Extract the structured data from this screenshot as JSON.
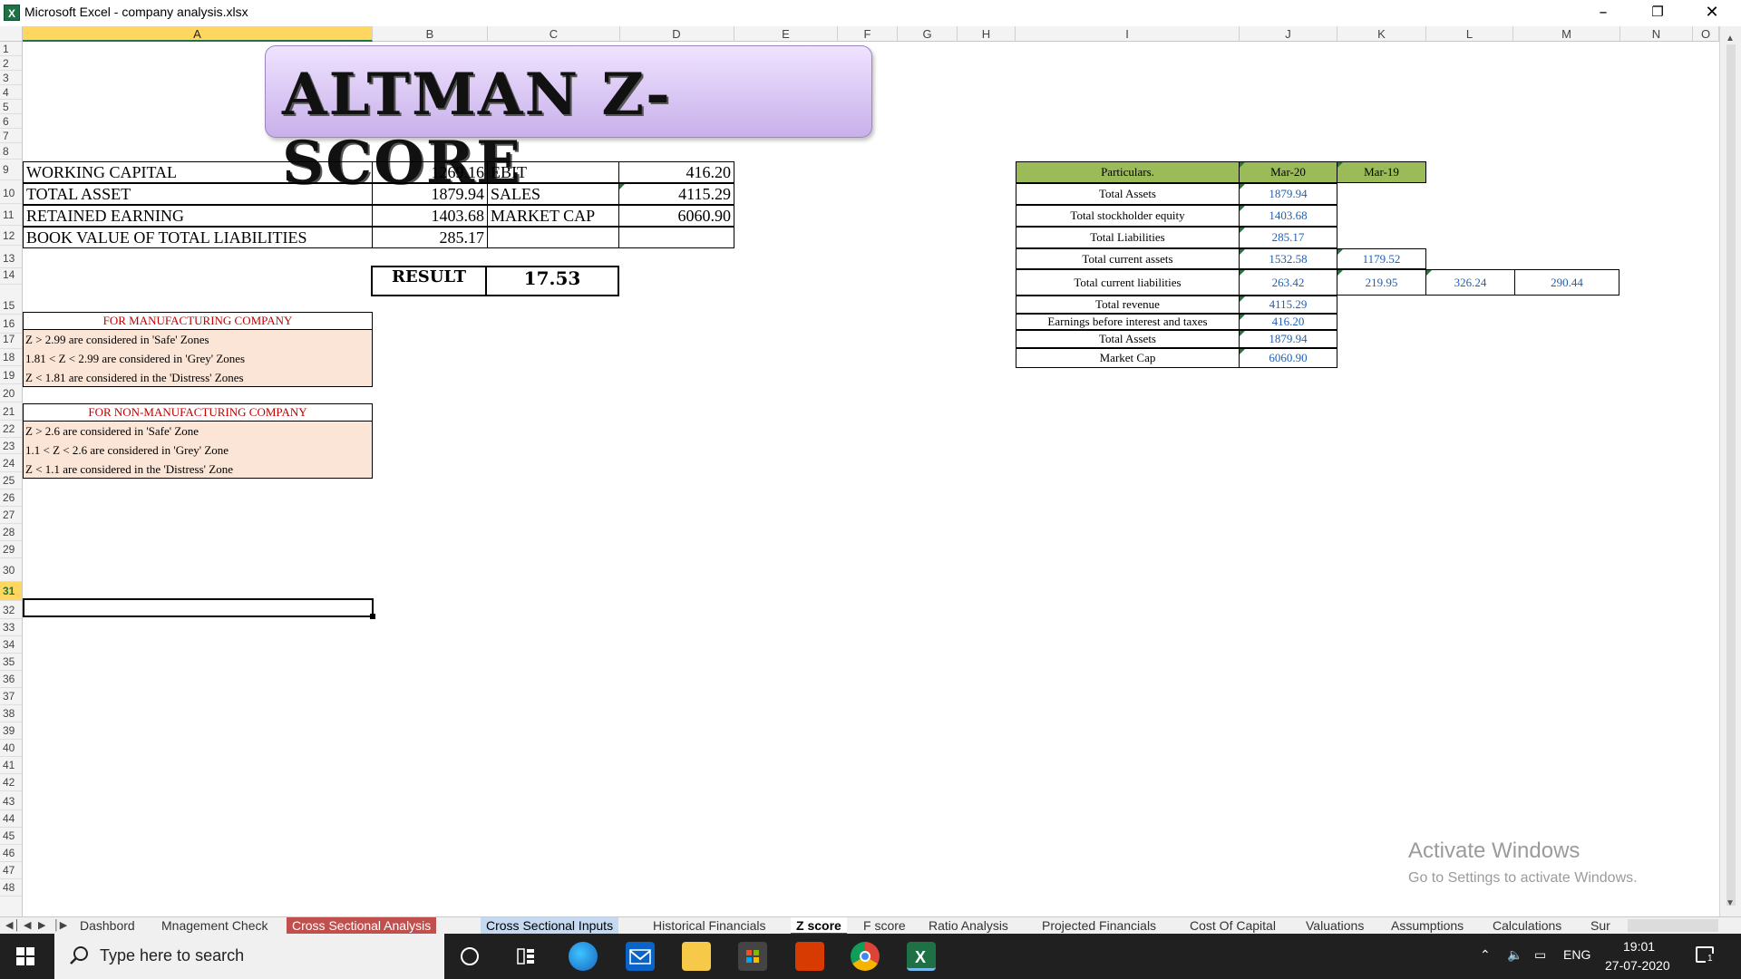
{
  "window": {
    "title": "Microsoft Excel - company analysis.xlsx",
    "app_icon": "X"
  },
  "columns": [
    "A",
    "B",
    "C",
    "D",
    "E",
    "F",
    "G",
    "H",
    "I",
    "J",
    "K",
    "L",
    "M",
    "N",
    "O"
  ],
  "rows": [
    "1",
    "2",
    "3",
    "4",
    "5",
    "6",
    "7",
    "8",
    "9",
    "10",
    "11",
    "12",
    "13",
    "14",
    "15",
    "16",
    "17",
    "18",
    "19",
    "20",
    "21",
    "22",
    "23",
    "24",
    "25",
    "26",
    "27",
    "28",
    "29",
    "30",
    "31",
    "32",
    "33",
    "34",
    "35",
    "36",
    "37",
    "38",
    "39",
    "40",
    "41",
    "42",
    "43",
    "44",
    "45",
    "46",
    "47",
    "48"
  ],
  "banner": {
    "text": "ALTMAN Z-SCORE"
  },
  "inputs": {
    "working_capital_label": "WORKING CAPITAL",
    "working_capital": "1269.16",
    "total_asset_label": "TOTAL ASSET",
    "total_asset": "1879.94",
    "retained_earning_label": "RETAINED EARNING",
    "retained_earning": "1403.68",
    "book_value_label": "BOOK VALUE OF TOTAL LIABILITIES",
    "book_value": "285.17",
    "ebit_label": "EBIT",
    "ebit": "416.20",
    "sales_label": "SALES",
    "sales": "4115.29",
    "market_cap_label": "MARKET CAP",
    "market_cap": "6060.90"
  },
  "result": {
    "label": "RESULT",
    "value": "17.53"
  },
  "manufacturing": {
    "heading": "FOR MANUFACTURING COMPANY",
    "lines": [
      "Z > 2.99 are considered in 'Safe' Zones",
      "1.81 < Z < 2.99 are considered in 'Grey' Zones",
      "Z < 1.81 are considered in the 'Distress' Zones"
    ]
  },
  "non_manufacturing": {
    "heading": "FOR NON-MANUFACTURING COMPANY",
    "lines": [
      "Z > 2.6 are considered in 'Safe' Zone",
      "1.1 < Z < 2.6 are considered in 'Grey' Zone",
      "Z < 1.1 are considered in the 'Distress' Zone"
    ]
  },
  "particulars": {
    "header": [
      "Particulars.",
      "Mar-20",
      "Mar-19"
    ],
    "rows": [
      {
        "label": "Total Assets",
        "mar20": "1879.94",
        "mar19": "",
        "l": "",
        "m": ""
      },
      {
        "label": "Total stockholder equity",
        "mar20": "1403.68",
        "mar19": "",
        "l": "",
        "m": ""
      },
      {
        "label": "Total Liabilities",
        "mar20": "285.17",
        "mar19": "",
        "l": "",
        "m": ""
      },
      {
        "label": "Total current assets",
        "mar20": "1532.58",
        "mar19": "1179.52",
        "l": "",
        "m": ""
      },
      {
        "label": "Total current liabilities",
        "mar20": "263.42",
        "mar19": "219.95",
        "l": "326.24",
        "m": "290.44"
      },
      {
        "label": "Total revenue",
        "mar20": "4115.29",
        "mar19": "",
        "l": "",
        "m": ""
      },
      {
        "label": "Earnings before interest and taxes",
        "mar20": "416.20",
        "mar19": "",
        "l": "",
        "m": ""
      },
      {
        "label": "Total Assets",
        "mar20": "1879.94",
        "mar19": "",
        "l": "",
        "m": ""
      },
      {
        "label": "Market Cap",
        "mar20": "6060.90",
        "mar19": "",
        "l": "",
        "m": ""
      }
    ]
  },
  "tabs": [
    {
      "label": "Dashbord",
      "style": "normal"
    },
    {
      "label": "Mnagement Check",
      "style": "normal"
    },
    {
      "label": "Cross Sectional Analysis",
      "style": "red"
    },
    {
      "label": "Cross Sectional Inputs",
      "style": "blue"
    },
    {
      "label": "Historical Financials",
      "style": "normal"
    },
    {
      "label": "Z score",
      "style": "active"
    },
    {
      "label": "F score",
      "style": "normal"
    },
    {
      "label": "Ratio Analysis",
      "style": "normal"
    },
    {
      "label": "Projected Financials",
      "style": "normal"
    },
    {
      "label": "Cost Of Capital",
      "style": "normal"
    },
    {
      "label": "Valuations",
      "style": "normal"
    },
    {
      "label": "Assumptions",
      "style": "normal"
    },
    {
      "label": "Calculations",
      "style": "normal"
    },
    {
      "label": "Sur",
      "style": "normal"
    }
  ],
  "watermark": {
    "line1": "Activate Windows",
    "line2": "Go to Settings to activate Windows."
  },
  "taskbar": {
    "search_placeholder": "Type here to search",
    "lang": "ENG",
    "time": "19:01",
    "date": "27-07-2020",
    "notifications": "1"
  }
}
